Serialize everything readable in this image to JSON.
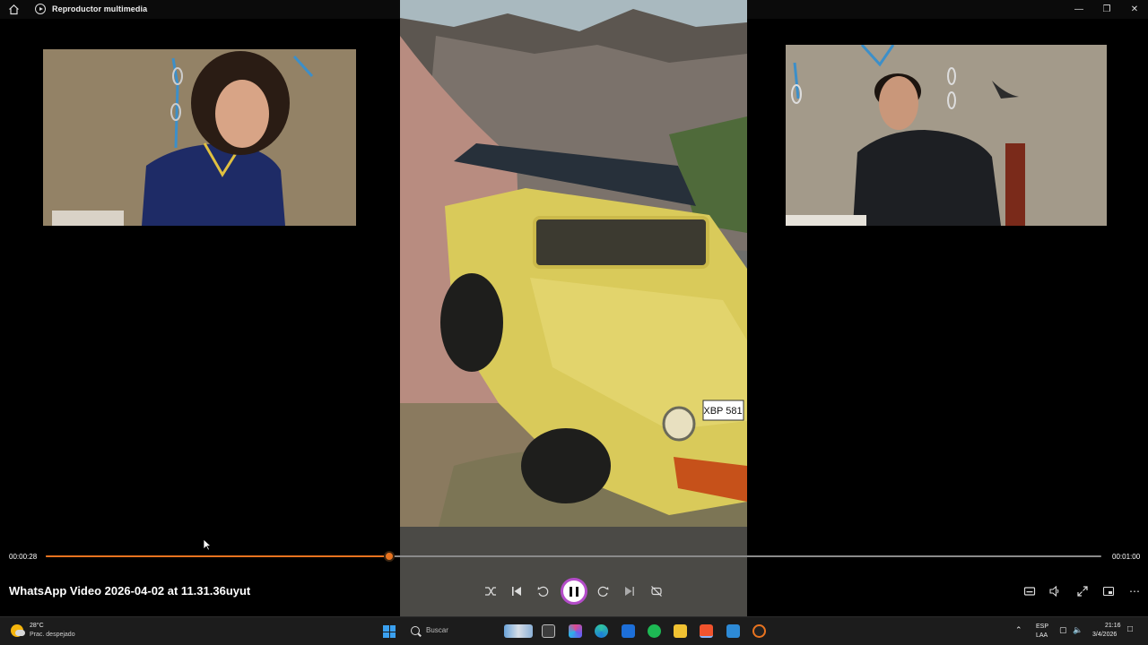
{
  "window": {
    "title": "Reproductor multimedia"
  },
  "player": {
    "current_time": "00:00:28",
    "total_time": "00:01:00",
    "progress": 0.325,
    "video_title": "WhatsApp Video 2026-04-02 at 11.31.36uyut",
    "accent_color": "#e8731f",
    "video_plate_text": "XBP 581"
  },
  "taskbar": {
    "weather_temp": "28°C",
    "weather_desc": "Prac. despejado",
    "search_placeholder": "Buscar",
    "lang_top": "ESP",
    "lang_bottom": "LAA",
    "clock_time": "21:16",
    "clock_date": "3/4/2026"
  }
}
